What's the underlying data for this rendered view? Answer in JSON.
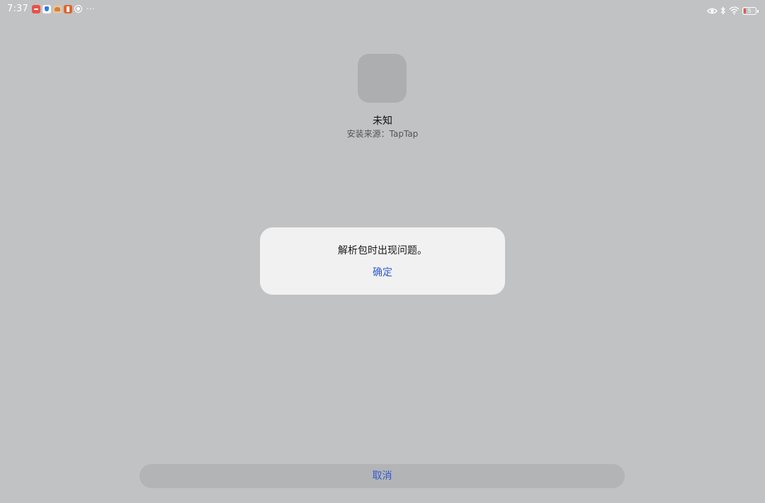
{
  "status_bar": {
    "time": "7:37",
    "more": "···",
    "notification_icons": [
      "red-app-icon",
      "security-shield-icon",
      "fox-app-icon",
      "orange-app-icon",
      "circle-app-icon"
    ],
    "system_icons": [
      "eye-icon",
      "bluetooth-icon",
      "wifi-icon",
      "battery-icon"
    ],
    "battery_level": "5",
    "battery_color": "#e8524a"
  },
  "app": {
    "name": "未知",
    "install_source": "安装来源：TapTap"
  },
  "dialog": {
    "message": "解析包时出现问题。",
    "confirm_label": "确定"
  },
  "footer": {
    "cancel_label": "取消"
  },
  "colors": {
    "background": "#c1c2c3",
    "accent": "#2f5bd0",
    "dialog_background": "#f1f1f1",
    "button_background": "#b3b4b5"
  }
}
